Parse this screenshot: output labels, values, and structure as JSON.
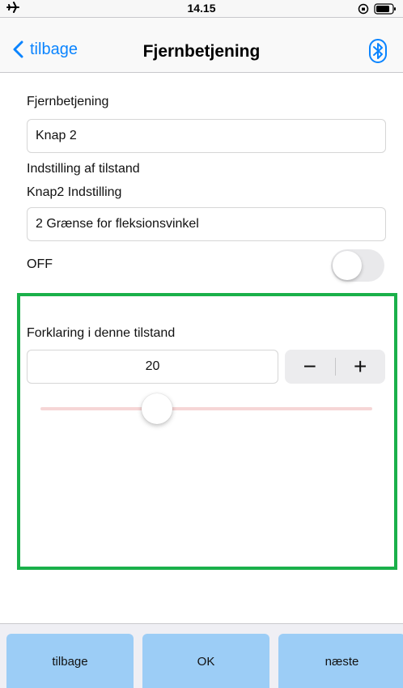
{
  "status_bar": {
    "time": "14.15",
    "left_icon": "airplane-icon",
    "right_icons": [
      "orientation-lock-icon",
      "battery-icon"
    ]
  },
  "nav": {
    "back_label": "tilbage",
    "title": "Fjernbetjening",
    "right_icon": "bluetooth-icon",
    "accent_color": "#0a84ff"
  },
  "form": {
    "remote_label": "Fjernbetjening",
    "remote_value": "Knap 2",
    "state_setting_label": "Indstilling af tilstand",
    "knap_setting_label": "Knap2 Indstilling",
    "knap_setting_value": "2 Grænse for fleksionsvinkel",
    "toggle_label": "OFF",
    "toggle_on": false
  },
  "panel": {
    "border_color": "#1ab04a",
    "explanation_label": "Forklaring i denne tilstand",
    "value": "20",
    "stepper_minus": "−",
    "stepper_plus": "+",
    "slider_fraction": 0.35
  },
  "bottom": {
    "back_label": "tilbage",
    "ok_label": "OK",
    "next_label": "næste",
    "button_color": "#9ccdf6"
  }
}
